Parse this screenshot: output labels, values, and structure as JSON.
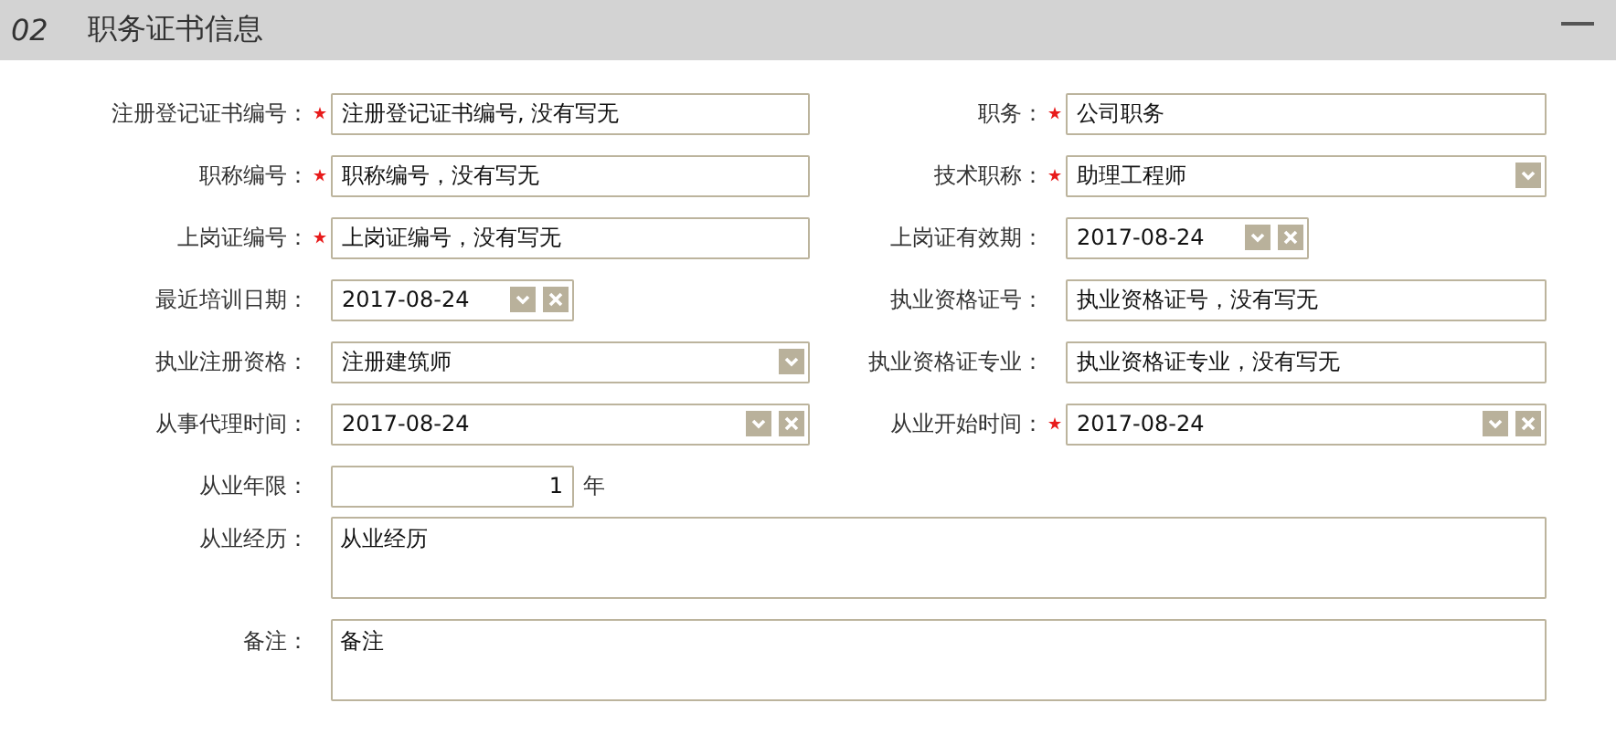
{
  "section": {
    "number": "02",
    "title": "职务证书信息",
    "collapse": true
  },
  "rows": [
    {
      "fields": [
        {
          "label": "注册登记证书编号：",
          "required": true,
          "kind": "text",
          "value": "注册登记证书编号, 没有写无"
        },
        {
          "label": "职务：",
          "required": true,
          "kind": "text",
          "value": "公司职务"
        }
      ]
    },
    {
      "fields": [
        {
          "label": "职称编号：",
          "required": true,
          "kind": "text",
          "value": "职称编号，没有写无"
        },
        {
          "label": "技术职称：",
          "required": true,
          "kind": "select",
          "value": "助理工程师"
        }
      ]
    },
    {
      "fields": [
        {
          "label": "上岗证编号：",
          "required": true,
          "kind": "text",
          "value": "上岗证编号，没有写无"
        },
        {
          "label": "上岗证有效期：",
          "required": false,
          "kind": "date",
          "value": "2017-08-24"
        }
      ]
    },
    {
      "fields": [
        {
          "label": "最近培训日期：",
          "required": false,
          "kind": "date",
          "value": "2017-08-24"
        },
        {
          "label": "执业资格证号：",
          "required": false,
          "kind": "text",
          "value": "执业资格证号，没有写无"
        }
      ]
    },
    {
      "fields": [
        {
          "label": "执业注册资格：",
          "required": false,
          "kind": "select",
          "value": "注册建筑师"
        },
        {
          "label": "执业资格证专业：",
          "required": false,
          "kind": "text",
          "value": "执业资格证专业，没有写无"
        }
      ]
    },
    {
      "fields": [
        {
          "label": "从事代理时间：",
          "required": false,
          "kind": "datewide",
          "value": "2017-08-24"
        },
        {
          "label": "从业开始时间：",
          "required": true,
          "kind": "datewide",
          "value": "2017-08-24"
        }
      ]
    },
    {
      "fields": [
        {
          "label": "从业年限：",
          "required": false,
          "kind": "number",
          "value": "1",
          "unit": "年"
        }
      ]
    },
    {
      "fields": [
        {
          "label": "从业经历：",
          "required": false,
          "kind": "textarea",
          "value": "从业经历"
        }
      ]
    },
    {
      "fields": [
        {
          "label": "备注：",
          "required": false,
          "kind": "textarea",
          "value": "备注"
        }
      ]
    }
  ]
}
